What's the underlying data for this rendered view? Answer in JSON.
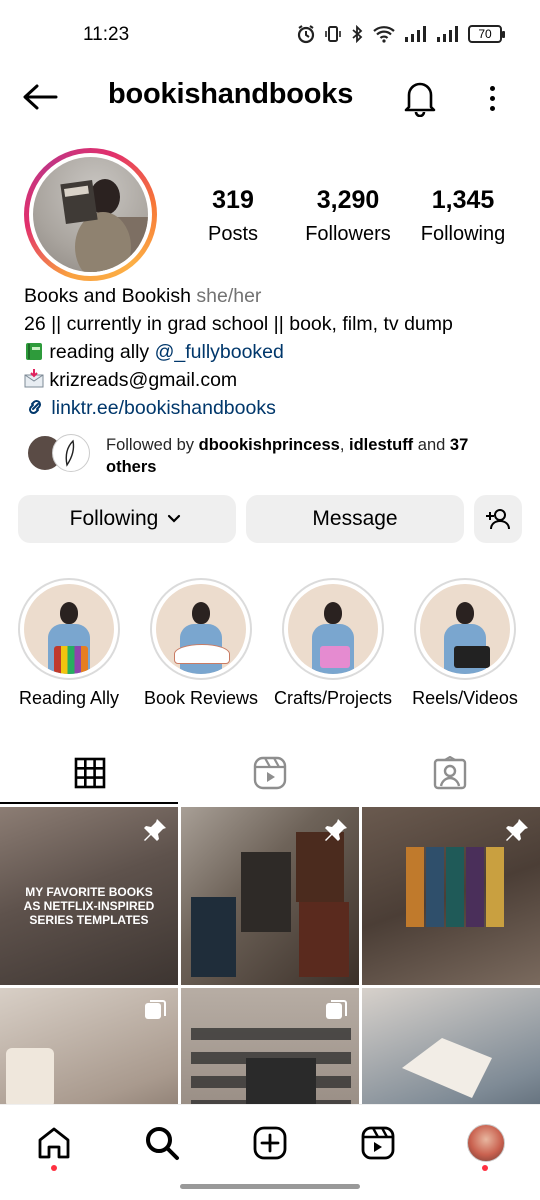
{
  "status_bar": {
    "time": "11:23",
    "battery": "70"
  },
  "header": {
    "username": "bookishandbooks"
  },
  "profile": {
    "stats": [
      {
        "value": "319",
        "label": "Posts"
      },
      {
        "value": "3,290",
        "label": "Followers"
      },
      {
        "value": "1,345",
        "label": "Following"
      }
    ],
    "bio": {
      "name": "Books and Bookish",
      "pronouns": "she/her",
      "line1": "26 || currently in grad school || book, film, tv dump",
      "line2_prefix": "reading ally ",
      "line2_mention": "@_fullybooked",
      "line3": "krizreads@gmail.com",
      "link": "linktr.ee/bookishandbooks"
    },
    "followed_by": {
      "prefix": "Followed by ",
      "user1": "dbookishprincess",
      "sep": ", ",
      "user2": "idlestuff",
      "and": " and ",
      "others": "37 others"
    }
  },
  "actions": {
    "following_label": "Following",
    "message_label": "Message"
  },
  "highlights": [
    {
      "label": "Reading Ally"
    },
    {
      "label": "Book Reviews"
    },
    {
      "label": "Crafts/Projects"
    },
    {
      "label": "Reels/Videos"
    }
  ],
  "tabs": [
    {
      "icon": "grid-icon",
      "active": true
    },
    {
      "icon": "reels-icon",
      "active": false
    },
    {
      "icon": "tagged-icon",
      "active": false
    }
  ],
  "posts": [
    {
      "text": "MY FAVORITE BOOKS AS NETFLIX-INSPIRED SERIES TEMPLATES",
      "pinned": true
    },
    {
      "pinned": true
    },
    {
      "pinned": true
    },
    {
      "multi": true
    },
    {
      "multi": true
    },
    {}
  ],
  "colors": {
    "link": "#00376b",
    "secondary_button": "#efefef",
    "notification_dot": "#ff3040"
  }
}
